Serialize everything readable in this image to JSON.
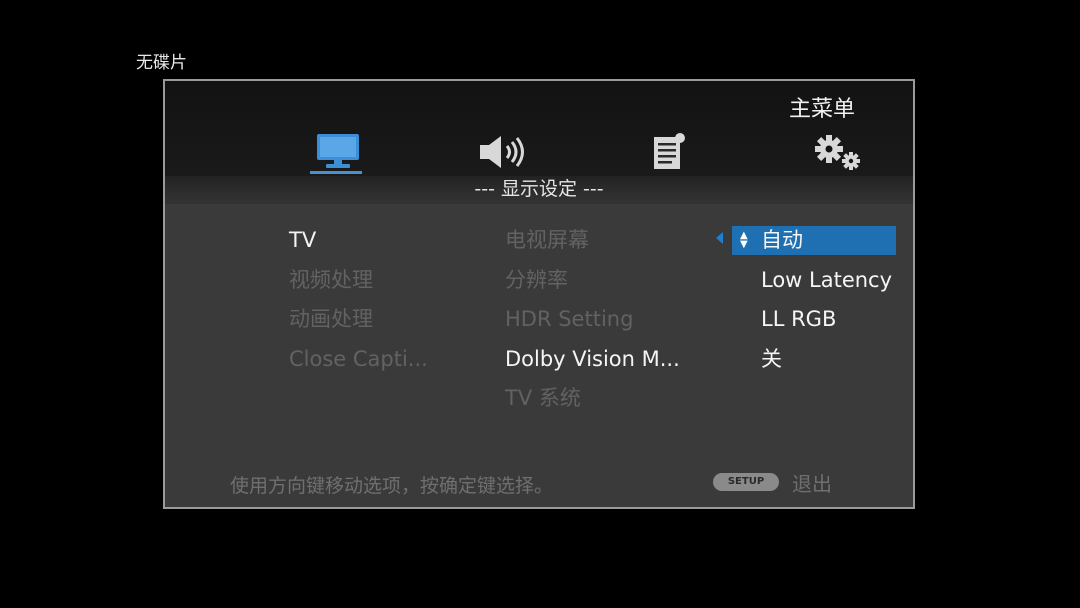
{
  "disc_status": "无碟片",
  "menu": {
    "title": "主菜单",
    "section": "--- 显示设定 ---",
    "categories": [
      {
        "icon": "monitor-icon",
        "selected": true
      },
      {
        "icon": "speaker-icon",
        "selected": false
      },
      {
        "icon": "document-icon",
        "selected": false
      },
      {
        "icon": "gear-icon",
        "selected": false
      }
    ]
  },
  "col1": [
    "TV",
    "视频处理",
    "动画处理",
    "Close Capti..."
  ],
  "col2": [
    "电视屏幕",
    "分辨率",
    "HDR Setting",
    "Dolby Vision M...",
    "TV 系统"
  ],
  "col3": [
    "自动",
    "Low Latency",
    "LL RGB",
    "关"
  ],
  "footer": {
    "hint": "使用方向键移动选项，按确定键选择。",
    "setup_button": "SETUP",
    "exit_label": "退出"
  },
  "colors": {
    "accent": "#1f6fb3",
    "panel": "#3a3a3a",
    "dim_text": "#626262"
  }
}
